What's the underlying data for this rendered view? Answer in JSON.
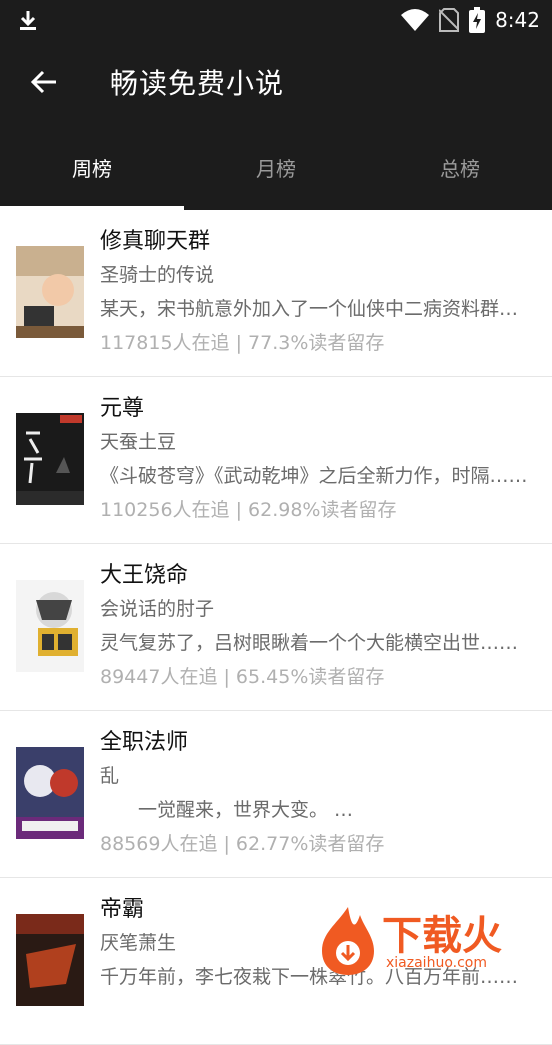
{
  "status_bar": {
    "time": "8:42"
  },
  "app_bar": {
    "title": "畅读免费小说"
  },
  "tabs": [
    {
      "label": "周榜"
    },
    {
      "label": "月榜"
    },
    {
      "label": "总榜"
    }
  ],
  "books": [
    {
      "title": "修真聊天群",
      "author": "圣骑士的传说",
      "desc": "某天，宋书航意外加入了一个仙侠中二病资料群……",
      "stat": "117815人在追 | 77.3%读者留存"
    },
    {
      "title": "元尊",
      "author": "天蚕土豆",
      "desc": "《斗破苍穹》《武动乾坤》之后全新力作，时隔……",
      "stat": "110256人在追 | 62.98%读者留存"
    },
    {
      "title": "大王饶命",
      "author": "会说话的肘子",
      "desc": "灵气复苏了，吕树眼瞅着一个个大能横空出世……",
      "stat": "89447人在追 | 65.45%读者留存"
    },
    {
      "title": "全职法师",
      "author": "乱",
      "desc": "　　一觉醒来，世界大变。 …",
      "stat": "88569人在追 | 62.77%读者留存"
    },
    {
      "title": "帝霸",
      "author": "厌笔萧生",
      "desc": "千万年前，李七夜栽下一株翠竹。八百万年前……",
      "stat": ""
    }
  ],
  "watermark": {
    "text": "下载火",
    "url": "xiazaihuo.com"
  }
}
